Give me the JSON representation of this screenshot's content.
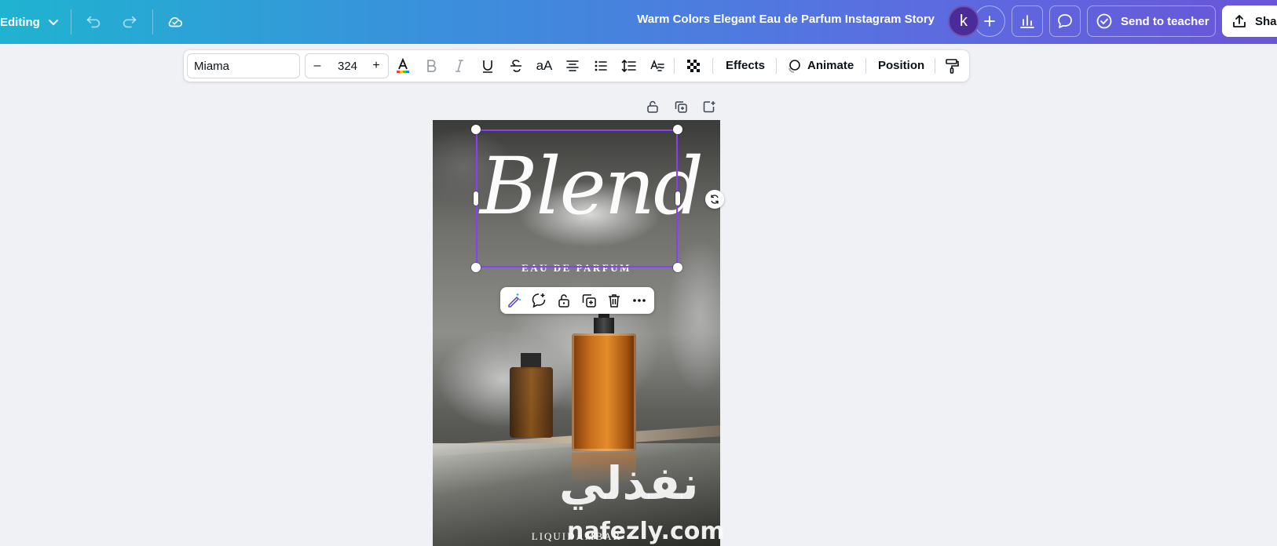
{
  "topbar": {
    "mode_label": "Editing",
    "doc_title": "Warm Colors Elegant Eau de Parfum Instagram Story",
    "avatar_letter": "k",
    "send_label": "Send to teacher",
    "share_label": "Share"
  },
  "toolbar": {
    "font_name": "Miama",
    "font_size": "324",
    "minus": "–",
    "plus": "+",
    "case_label": "aA",
    "effects_label": "Effects",
    "animate_label": "Animate",
    "position_label": "Position"
  },
  "design": {
    "headline": "Blend",
    "subheading": "EAU DE PARFUM",
    "footer": "LIQUIDAMBAR"
  },
  "watermark": {
    "arabic": "نفذلي",
    "latin": "nafezly.com"
  },
  "colors": {
    "selection": "#8b3dff",
    "gradient_start": "#1fb3d0",
    "gradient_end": "#6a55d8"
  }
}
